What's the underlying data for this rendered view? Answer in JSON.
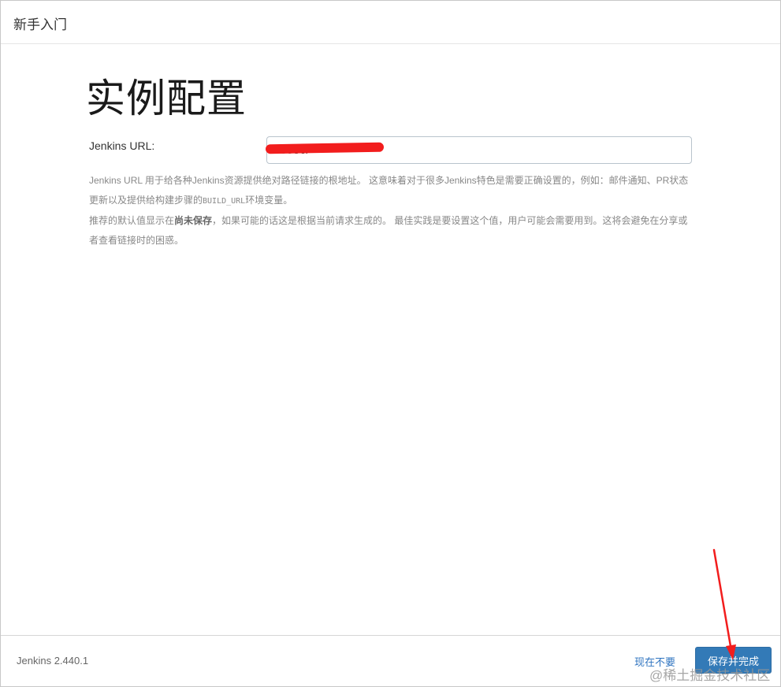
{
  "dialog": {
    "title": "新手入门"
  },
  "main": {
    "heading": "实例配置",
    "url_field": {
      "label": "Jenkins URL:",
      "value": ":8080/"
    },
    "help": {
      "p1_text": "Jenkins URL 用于给各种Jenkins资源提供绝对路径链接的根地址。 这意味着对于很多Jenkins特色是需要正确设置的，例如：邮件通知、PR状态更新以及提供给构建步骤的",
      "p1_code": "BUILD_URL",
      "p1_suffix": "环境变量。",
      "p2_prefix": "推荐的默认值显示在",
      "p2_bold": "尚未保存",
      "p2_suffix": "，如果可能的话这是根据当前请求生成的。 最佳实践是要设置这个值，用户可能会需要用到。这将会避免在分享或者查看链接时的困惑。"
    }
  },
  "footer": {
    "version": "Jenkins 2.440.1",
    "skip_label": "现在不要",
    "save_label": "保存并完成"
  },
  "watermark": "@稀土掘金技术社区",
  "colors": {
    "primary_button": "#337ab7",
    "link": "#2f74c0",
    "annotation": "#f21d1d"
  }
}
